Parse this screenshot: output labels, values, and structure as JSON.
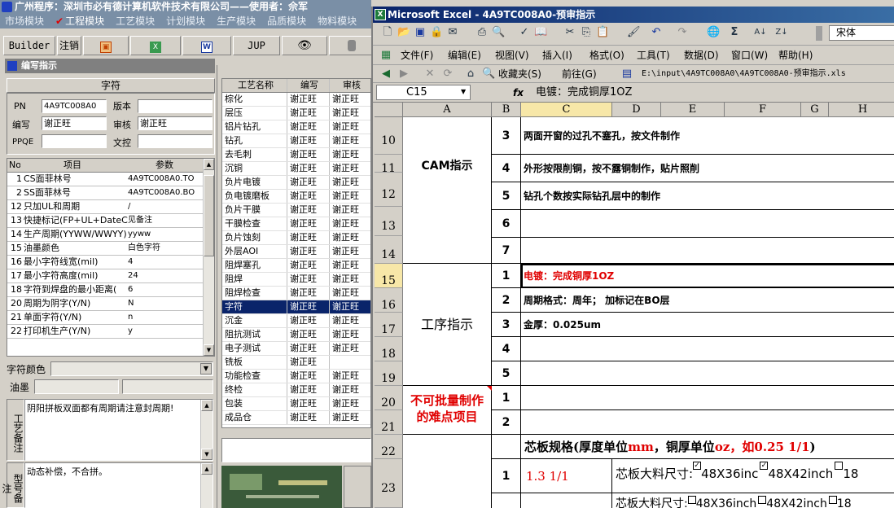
{
  "left_app": {
    "title": "广州程序：深圳市必有德计算机软件技术有限公司——使用者：佘军",
    "menu": [
      "市场模块",
      "工程模块",
      "工艺模块",
      "计划模块",
      "生产模块",
      "品质模块",
      "物料模块"
    ],
    "toolbar": {
      "builder": "Builder",
      "logout": "注销",
      "jup": "JUP"
    },
    "panel_title": "编写指示",
    "char_header": "字符",
    "fields": {
      "pn_label": "PN",
      "pn_value": "4A9TC008A0",
      "version_label": "版本",
      "version_value": "",
      "writer_label": "编写",
      "writer_value": "谢正旺",
      "review_label": "审核",
      "review_value": "谢正旺",
      "ppqe_label": "PPQE",
      "ppqe_value": "",
      "wenkong_label": "文控",
      "wenkong_value": ""
    },
    "param_table": {
      "headers": [
        "No",
        "项目",
        "参数"
      ],
      "rows": [
        [
          "1",
          "CS面菲林号",
          "4A9TC008A0.TO"
        ],
        [
          "2",
          "SS面菲林号",
          "4A9TC008A0.BO"
        ],
        [
          "12",
          "只加UL和周期",
          "/"
        ],
        [
          "13",
          "快捷标记(FP+UL+DateCo",
          "见备注"
        ],
        [
          "14",
          "生产周期(YYWW/WWYY)",
          "yyww"
        ],
        [
          "15",
          "油墨颜色",
          "白色字符"
        ],
        [
          "16",
          "最小字符线宽(mil)",
          "4"
        ],
        [
          "17",
          "最小字符高度(mil)",
          "24"
        ],
        [
          "18",
          "字符到焊盘的最小距离(",
          "6"
        ],
        [
          "20",
          "周期为阴字(Y/N)",
          "N"
        ],
        [
          "21",
          "单面字符(Y/N)",
          "n"
        ],
        [
          "22",
          "打印机生产(Y/N)",
          "y"
        ]
      ]
    },
    "char_color_label": "字符颜色",
    "ink_label": "油墨",
    "process_note_label": "工艺备注",
    "process_note_text": "阴阳拼板双面都有周期请注意封周期!",
    "type_note_label": "型号备注",
    "type_note_text": "动态补偿，不合拼。",
    "op_table": {
      "headers": [
        "工艺名称",
        "编写",
        "审核"
      ],
      "rows": [
        [
          "棕化",
          "谢正旺",
          "谢正旺"
        ],
        [
          "层压",
          "谢正旺",
          "谢正旺"
        ],
        [
          "铝片钻孔",
          "谢正旺",
          "谢正旺"
        ],
        [
          "钻孔",
          "谢正旺",
          "谢正旺"
        ],
        [
          "去毛刺",
          "谢正旺",
          "谢正旺"
        ],
        [
          "沉铜",
          "谢正旺",
          "谢正旺"
        ],
        [
          "负片电镀",
          "谢正旺",
          "谢正旺"
        ],
        [
          "负电镀磨板",
          "谢正旺",
          "谢正旺"
        ],
        [
          "负片干膜",
          "谢正旺",
          "谢正旺"
        ],
        [
          "干膜检查",
          "谢正旺",
          "谢正旺"
        ],
        [
          "负片蚀刻",
          "谢正旺",
          "谢正旺"
        ],
        [
          "外层AOI",
          "谢正旺",
          "谢正旺"
        ],
        [
          "阻焊塞孔",
          "谢正旺",
          "谢正旺"
        ],
        [
          "阻焊",
          "谢正旺",
          "谢正旺"
        ],
        [
          "阻焊检查",
          "谢正旺",
          "谢正旺"
        ],
        [
          "字符",
          "谢正旺",
          "谢正旺"
        ],
        [
          "沉金",
          "谢正旺",
          "谢正旺"
        ],
        [
          "阻抗测试",
          "谢正旺",
          "谢正旺"
        ],
        [
          "电子测试",
          "谢正旺",
          "谢正旺"
        ],
        [
          "铣板",
          "谢正旺",
          ""
        ],
        [
          "功能检查",
          "谢正旺",
          "谢正旺"
        ],
        [
          "终检",
          "谢正旺",
          "谢正旺"
        ],
        [
          "包装",
          "谢正旺",
          "谢正旺"
        ],
        [
          "成品仓",
          "谢正旺",
          "谢正旺"
        ]
      ],
      "selected_index": 15
    }
  },
  "excel": {
    "title": "Microsoft Excel - 4A9TC008A0-预审指示",
    "font_name": "宋体",
    "menu": [
      "文件(F)",
      "编辑(E)",
      "视图(V)",
      "插入(I)",
      "格式(O)",
      "工具(T)",
      "数据(D)",
      "窗口(W)",
      "帮助(H)"
    ],
    "web_bar": {
      "favorites": "收藏夹(S)",
      "go": "前往(G)",
      "path": "E:\\input\\4A9TC008A0\\4A9TC008A0-预审指示.xls"
    },
    "name_box": "C15",
    "fx_label": "fx",
    "formula": "电镀：完成铜厚1OZ",
    "columns": [
      "A",
      "B",
      "C",
      "D",
      "E",
      "F",
      "G",
      "H"
    ],
    "rows": [
      "10",
      "11",
      "12",
      "13",
      "14",
      "15",
      "16",
      "17",
      "18",
      "19",
      "20",
      "21",
      "22",
      "23"
    ],
    "section_cam": "CAM指示",
    "section_process": "工序指示",
    "section_hard": "不可批量制作的难点项目",
    "cam_items": [
      [
        "3",
        "两面开窗的过孔不塞孔，按文件制作"
      ],
      [
        "4",
        "外形按限削铜，按不露铜制作，贴片照削"
      ],
      [
        "5",
        "钻孔个数按实际钻孔层中的制作"
      ],
      [
        "6",
        ""
      ],
      [
        "7",
        ""
      ]
    ],
    "process_items": [
      [
        "1",
        "电镀：完成铜厚1OZ"
      ],
      [
        "2",
        "周期格式：周年； 加标记在BO层"
      ],
      [
        "3",
        "金厚：0.025um"
      ],
      [
        "4",
        ""
      ],
      [
        "5",
        ""
      ]
    ],
    "hard_items": [
      [
        "1",
        ""
      ],
      [
        "2",
        ""
      ]
    ],
    "core_spec": {
      "prefix": "芯板规格(厚度单位",
      "mm": "mm",
      "mid": "，铜厚单位",
      "oz": "oz",
      "eg": "，如0.25 1/1",
      ")": ")"
    },
    "row23": {
      "num": "1",
      "spec": "1.3 1/1",
      "label": "芯板大料尺寸:",
      "opt1": "48X36inc",
      "opt2": "48X42inch",
      "opt3": "18",
      "next_label": "芯板大料尺寸:",
      "next1": "48X36inch",
      "next2": "48X42inch",
      "next3": "18"
    }
  }
}
